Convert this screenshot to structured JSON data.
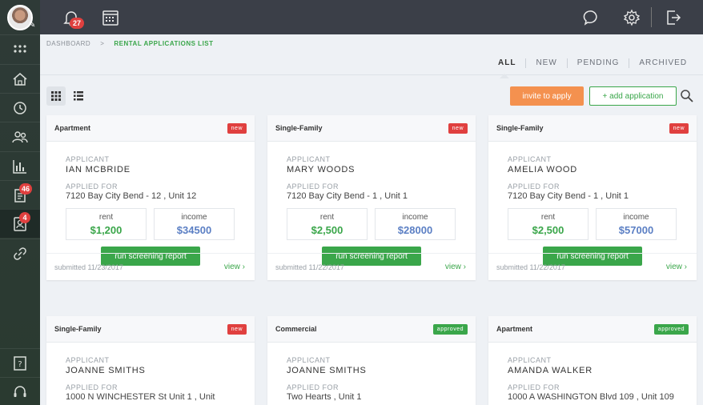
{
  "sidebar": {
    "items": [
      {
        "icon": "grid-dots-icon"
      },
      {
        "icon": "house-icon"
      },
      {
        "icon": "refresh-icon"
      },
      {
        "icon": "users-icon"
      },
      {
        "icon": "bar-chart-icon"
      },
      {
        "icon": "document-icon",
        "badge": "46"
      },
      {
        "icon": "applicant-icon",
        "badge": "4"
      },
      {
        "icon": "link-icon"
      },
      {
        "icon": "help-icon"
      },
      {
        "icon": "headset-icon"
      }
    ]
  },
  "topbar": {
    "notifications_badge": "27"
  },
  "breadcrumb": {
    "root": "DASHBOARD",
    "separator": ">",
    "current": "RENTAL APPLICATIONS LIST"
  },
  "tabs": [
    "ALL",
    "NEW",
    "PENDING",
    "ARCHIVED"
  ],
  "active_tab": "ALL",
  "actions": {
    "invite": "invite to apply",
    "add": "+ add application"
  },
  "colors": {
    "accent": "#3aa64a",
    "orange": "#f4914f",
    "danger": "#e0403f",
    "income": "#5b7fc4"
  },
  "labels": {
    "applicant": "APPLICANT",
    "applied_for": "APPLIED FOR",
    "rent": "rent",
    "income": "income",
    "screen": "run screening report",
    "view": "view ›"
  },
  "cards": [
    {
      "type": "Apartment",
      "status": "new",
      "applicant": "IAN MCBRIDE",
      "address": "7120 Bay City Bend - 12 , Unit 12",
      "rent": "$1,200",
      "income": "$34500",
      "submitted": "submitted 11/23/2017"
    },
    {
      "type": "Single-Family",
      "status": "new",
      "applicant": "MARY WOODS",
      "address": "7120 Bay City Bend - 1 , Unit 1",
      "rent": "$2,500",
      "income": "$28000",
      "submitted": "submitted 11/22/2017"
    },
    {
      "type": "Single-Family",
      "status": "new",
      "applicant": "AMELIA WOOD",
      "address": "7120 Bay City Bend - 1 , Unit 1",
      "rent": "$2,500",
      "income": "$57000",
      "submitted": "submitted 11/22/2017"
    },
    {
      "type": "Single-Family",
      "status": "new",
      "applicant": "JOANNE SMITHS",
      "address": "1000 N WINCHESTER St Unit 1 , Unit"
    },
    {
      "type": "Commercial",
      "status": "approved",
      "applicant": "JOANNE SMITHS",
      "address": "Two Hearts , Unit 1"
    },
    {
      "type": "Apartment",
      "status": "approved",
      "applicant": "AMANDA WALKER",
      "address": "1000 A WASHINGTON Blvd 109 , Unit 109"
    }
  ]
}
